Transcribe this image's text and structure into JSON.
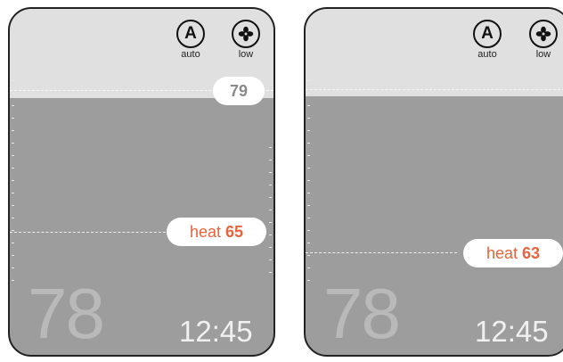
{
  "screens": [
    {
      "modes": {
        "mode": {
          "glyph": "A",
          "label": "auto",
          "icon": "auto-mode-icon"
        },
        "fan": {
          "label": "low",
          "icon": "fan-icon"
        }
      },
      "cool_setpoint": "79",
      "heat_setpoint": {
        "label": "heat",
        "value": "65"
      },
      "current_temp": "78",
      "time": "12:45"
    },
    {
      "modes": {
        "mode": {
          "glyph": "A",
          "label": "auto",
          "icon": "auto-mode-icon"
        },
        "fan": {
          "label": "low",
          "icon": "fan-icon"
        }
      },
      "heat_setpoint": {
        "label": "heat",
        "value": "63"
      },
      "current_temp": "78",
      "time": "12:45"
    }
  ],
  "colors": {
    "heat_accent": "#e8643c",
    "panel_gray": "#9d9d9d",
    "top_band": "#e0e0e0"
  }
}
